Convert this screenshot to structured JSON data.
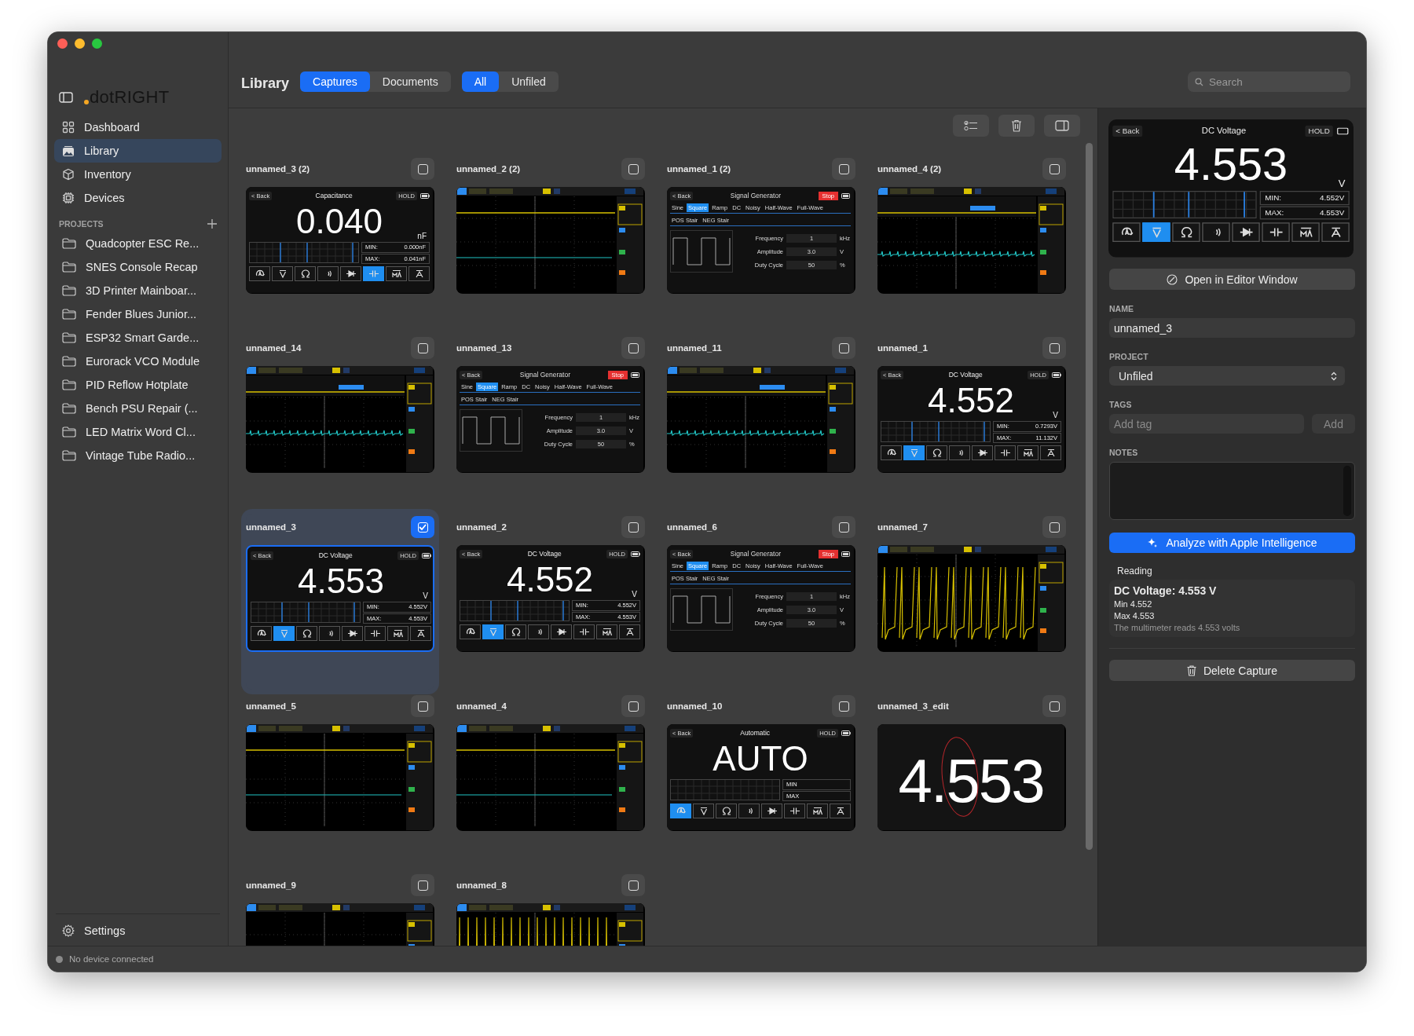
{
  "sidebar": {
    "logo": "dotRIGHT",
    "nav": [
      {
        "label": "Dashboard",
        "selected": false
      },
      {
        "label": "Library",
        "selected": true
      },
      {
        "label": "Inventory",
        "selected": false
      },
      {
        "label": "Devices",
        "selected": false
      }
    ],
    "projects_header": "PROJECTS",
    "projects": [
      "Quadcopter ESC Re...",
      "SNES Console Recap",
      "3D Printer Mainboar...",
      "Fender Blues Junior...",
      "ESP32 Smart Garde...",
      "Eurorack VCO Module",
      "PID Reflow Hotplate",
      "Bench PSU Repair (...",
      "LED Matrix Word Cl...",
      "Vintage Tube Radio..."
    ],
    "settings": "Settings"
  },
  "toolbar": {
    "title": "Library",
    "source_tabs": [
      {
        "label": "Captures",
        "selected": true
      },
      {
        "label": "Documents",
        "selected": false
      }
    ],
    "filter_tabs": [
      {
        "label": "All",
        "selected": true
      },
      {
        "label": "Unfiled",
        "selected": false
      }
    ],
    "search": {
      "placeholder": "Search"
    }
  },
  "captures": [
    {
      "name": "unnamed_3 (2)",
      "selected": false,
      "kind": "meter",
      "meter": {
        "kind": "capacitance",
        "back": "< Back",
        "title": "Capacitance",
        "hold": "HOLD",
        "value": "0.040",
        "unit": "nF",
        "min_label": "MIN:",
        "min": "0.000nF",
        "max_label": "MAX:",
        "max": "0.041nF"
      }
    },
    {
      "name": "unnamed_2 (2)",
      "selected": false,
      "kind": "scope",
      "scope": {
        "kind": "flat"
      }
    },
    {
      "name": "unnamed_1 (2)",
      "selected": false,
      "kind": "generator",
      "generator": {
        "back": "< Back",
        "title": "Signal Generator",
        "state": "Stop",
        "waves": [
          {
            "label": "Sine",
            "selected": false
          },
          {
            "label": "Square",
            "selected": true
          },
          {
            "label": "Ramp",
            "selected": false
          },
          {
            "label": "DC",
            "selected": false
          },
          {
            "label": "Noisy",
            "selected": false
          },
          {
            "label": "Half-Wave",
            "selected": false
          },
          {
            "label": "Full-Wave",
            "selected": false
          }
        ],
        "stairs": [
          "POS Stair",
          "NEG Stair"
        ],
        "params": [
          {
            "label": "Frequency",
            "value": "1",
            "unit": "kHz"
          },
          {
            "label": "Amplitude",
            "value": "3.0",
            "unit": "V"
          },
          {
            "label": "Duty Cycle",
            "value": "50",
            "unit": "%"
          }
        ]
      }
    },
    {
      "name": "unnamed_4 (2)",
      "selected": false,
      "kind": "scope",
      "scope": {
        "kind": "menu"
      }
    },
    {
      "name": "unnamed_14",
      "selected": false,
      "kind": "scope",
      "scope": {
        "kind": "menu"
      }
    },
    {
      "name": "unnamed_13",
      "selected": false,
      "kind": "generator",
      "generator": {
        "back": "< Back",
        "title": "Signal Generator",
        "state": "Stop",
        "waves": [
          {
            "label": "Sine",
            "selected": false
          },
          {
            "label": "Square",
            "selected": true
          },
          {
            "label": "Ramp",
            "selected": false
          },
          {
            "label": "DC",
            "selected": false
          },
          {
            "label": "Noisy",
            "selected": false
          },
          {
            "label": "Half-Wave",
            "selected": false
          },
          {
            "label": "Full-Wave",
            "selected": false
          }
        ],
        "stairs": [
          "POS Stair",
          "NEG Stair"
        ],
        "params": [
          {
            "label": "Frequency",
            "value": "1",
            "unit": "kHz"
          },
          {
            "label": "Amplitude",
            "value": "3.0",
            "unit": "V"
          },
          {
            "label": "Duty Cycle",
            "value": "50",
            "unit": "%"
          }
        ]
      }
    },
    {
      "name": "unnamed_11",
      "selected": false,
      "kind": "scope",
      "scope": {
        "kind": "menu"
      }
    },
    {
      "name": "unnamed_1",
      "selected": false,
      "kind": "meter",
      "meter": {
        "kind": "dc-voltage",
        "back": "< Back",
        "title": "DC Voltage",
        "hold": "HOLD",
        "value": "4.552",
        "unit": "V",
        "min_label": "MIN:",
        "min": "0.7293V",
        "max_label": "MAX:",
        "max": "11.132V"
      }
    },
    {
      "name": "unnamed_3",
      "selected": true,
      "kind": "meter",
      "meter": {
        "kind": "dc-voltage",
        "back": "< Back",
        "title": "DC Voltage",
        "hold": "HOLD",
        "value": "4.553",
        "unit": "V",
        "min_label": "MIN:",
        "min": "4.552V",
        "max_label": "MAX:",
        "max": "4.553V"
      }
    },
    {
      "name": "unnamed_2",
      "selected": false,
      "kind": "meter",
      "meter": {
        "kind": "dc-voltage",
        "back": "< Back",
        "title": "DC Voltage",
        "hold": "HOLD",
        "value": "4.552",
        "unit": "V",
        "min_label": "MIN:",
        "min": "4.552V",
        "max_label": "MAX:",
        "max": "4.553V"
      }
    },
    {
      "name": "unnamed_6",
      "selected": false,
      "kind": "generator",
      "generator": {
        "back": "< Back",
        "title": "Signal Generator",
        "state": "Stop",
        "waves": [
          {
            "label": "Sine",
            "selected": false
          },
          {
            "label": "Square",
            "selected": true
          },
          {
            "label": "Ramp",
            "selected": false
          },
          {
            "label": "DC",
            "selected": false
          },
          {
            "label": "Noisy",
            "selected": false
          },
          {
            "label": "Half-Wave",
            "selected": false
          },
          {
            "label": "Full-Wave",
            "selected": false
          }
        ],
        "stairs": [
          "POS Stair",
          "NEG Stair"
        ],
        "params": [
          {
            "label": "Frequency",
            "value": "1",
            "unit": "kHz"
          },
          {
            "label": "Amplitude",
            "value": "3.0",
            "unit": "V"
          },
          {
            "label": "Duty Cycle",
            "value": "50",
            "unit": "%"
          }
        ]
      }
    },
    {
      "name": "unnamed_7",
      "selected": false,
      "kind": "scope",
      "scope": {
        "kind": "sawtooth"
      }
    },
    {
      "name": "unnamed_5",
      "selected": false,
      "kind": "scope",
      "scope": {
        "kind": "flat"
      }
    },
    {
      "name": "unnamed_4",
      "selected": false,
      "kind": "scope",
      "scope": {
        "kind": "flat"
      }
    },
    {
      "name": "unnamed_10",
      "selected": false,
      "kind": "meter",
      "meter": {
        "kind": "auto",
        "back": "< Back",
        "title": "Automatic",
        "hold": "HOLD",
        "value": "AUTO",
        "min_label": "MIN",
        "max_label": "MAX"
      }
    },
    {
      "name": "unnamed_3_edit",
      "selected": false,
      "kind": "zoomed",
      "value": "4.553"
    },
    {
      "name": "unnamed_9",
      "selected": false,
      "kind": "scope",
      "scope": {
        "kind": "decay"
      }
    },
    {
      "name": "unnamed_8",
      "selected": false,
      "kind": "scope",
      "scope": {
        "kind": "spikes"
      }
    }
  ],
  "detail": {
    "preview": {
      "kind": "dc-voltage",
      "back": "< Back",
      "title": "DC Voltage",
      "hold": "HOLD",
      "value": "4.553",
      "unit": "V",
      "min_label": "MIN:",
      "min": "4.552V",
      "max_label": "MAX:",
      "max": "4.553V"
    },
    "open_button": "Open in Editor Window",
    "name_label": "NAME",
    "name_value": "unnamed_3",
    "project_label": "PROJECT",
    "project_value": "Unfiled",
    "tags_label": "TAGS",
    "tags_placeholder": "Add tag",
    "add_button": "Add",
    "notes_label": "NOTES",
    "analyze_button": "Analyze with Apple Intelligence",
    "reading_heading": "Reading",
    "reading_title": "DC Voltage: 4.553 V",
    "reading_lines": [
      "Min 4.552",
      "Max 4.553"
    ],
    "reading_note": "The multimeter reads 4.553 volts",
    "delete_button": "Delete Capture"
  },
  "status_bar": {
    "text": "No device connected",
    "connected": false
  }
}
